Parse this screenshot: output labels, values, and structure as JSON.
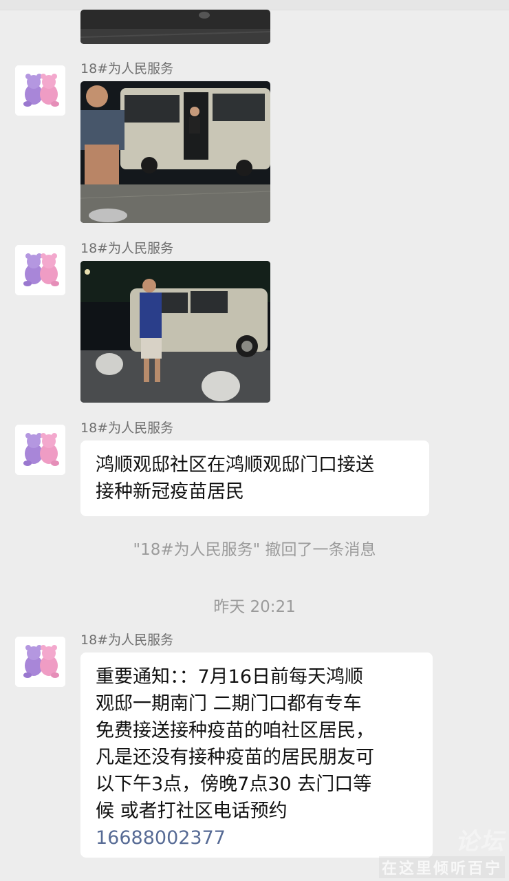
{
  "messages": [
    {
      "type": "image",
      "sender": "",
      "icon": "van-photo-partial"
    },
    {
      "type": "image",
      "sender": "18#为人民服务",
      "icon": "van-photo-man-seated"
    },
    {
      "type": "image",
      "sender": "18#为人民服务",
      "icon": "van-photo-man-standing"
    },
    {
      "type": "text",
      "sender": "18#为人民服务",
      "lines": [
        "鸿顺观邸社区在鸿顺观邸门口接送",
        "接种新冠疫苗居民"
      ]
    },
    {
      "type": "text",
      "sender": "18#为人民服务",
      "lines": [
        "重要通知：：7月16日前每天鸿顺",
        "观邸一期南门 二期门口都有专车",
        "免费接送接种疫苗的咱社区居民，",
        "凡是还没有接种疫苗的居民朋友可",
        "以下午3点，傍晚7点30 去门口等",
        "候  或者打社区电话预约"
      ],
      "phone": "16688002377"
    }
  ],
  "system": {
    "recall_notice": "\"18#为人民服务\" 撤回了一条消息",
    "timestamp": "昨天 20:21"
  },
  "watermark": {
    "top": "论坛",
    "bottom": "在这里倾听百宁"
  },
  "colors": {
    "background": "#ededed",
    "bubble": "#ffffff",
    "link": "#576b95",
    "sender": "#6f6f6f",
    "system_text": "#9b9b9b"
  },
  "avatar_icon": "plush-bears-avatar"
}
